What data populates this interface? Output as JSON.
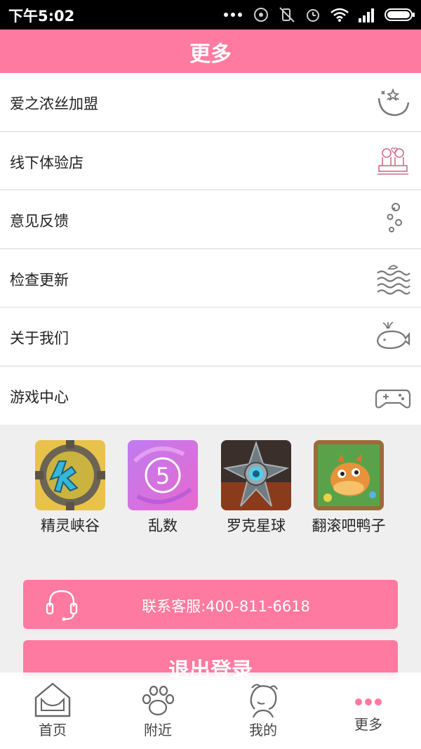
{
  "status_bar": {
    "time": "下午5:02"
  },
  "header": {
    "title": "更多"
  },
  "menu": [
    {
      "label": "爱之浓丝加盟",
      "icon": "moon-icon"
    },
    {
      "label": "线下体验店",
      "icon": "couple-icon"
    },
    {
      "label": "意见反馈",
      "icon": "bubbles-icon"
    },
    {
      "label": "检查更新",
      "icon": "waves-icon"
    },
    {
      "label": "关于我们",
      "icon": "whale-icon"
    },
    {
      "label": "游戏中心",
      "icon": "gamepad-icon"
    }
  ],
  "games": [
    {
      "name": "精灵峡谷"
    },
    {
      "name": "乱数",
      "badge": "5"
    },
    {
      "name": "罗克星球"
    },
    {
      "name": "翻滚吧鸭子"
    }
  ],
  "service_button": {
    "label": "联系客服:400-811-6618"
  },
  "logout_button": {
    "label": "退出登录"
  },
  "tabs": [
    {
      "label": "首页",
      "icon": "home-icon",
      "active": false
    },
    {
      "label": "附近",
      "icon": "paw-icon",
      "active": false
    },
    {
      "label": "我的",
      "icon": "profile-icon",
      "active": false
    },
    {
      "label": "更多",
      "icon": "more-dots-icon",
      "active": true
    }
  ],
  "colors": {
    "accent": "#ff7aa0",
    "background": "#efefef",
    "divider": "#d6d6d6"
  }
}
